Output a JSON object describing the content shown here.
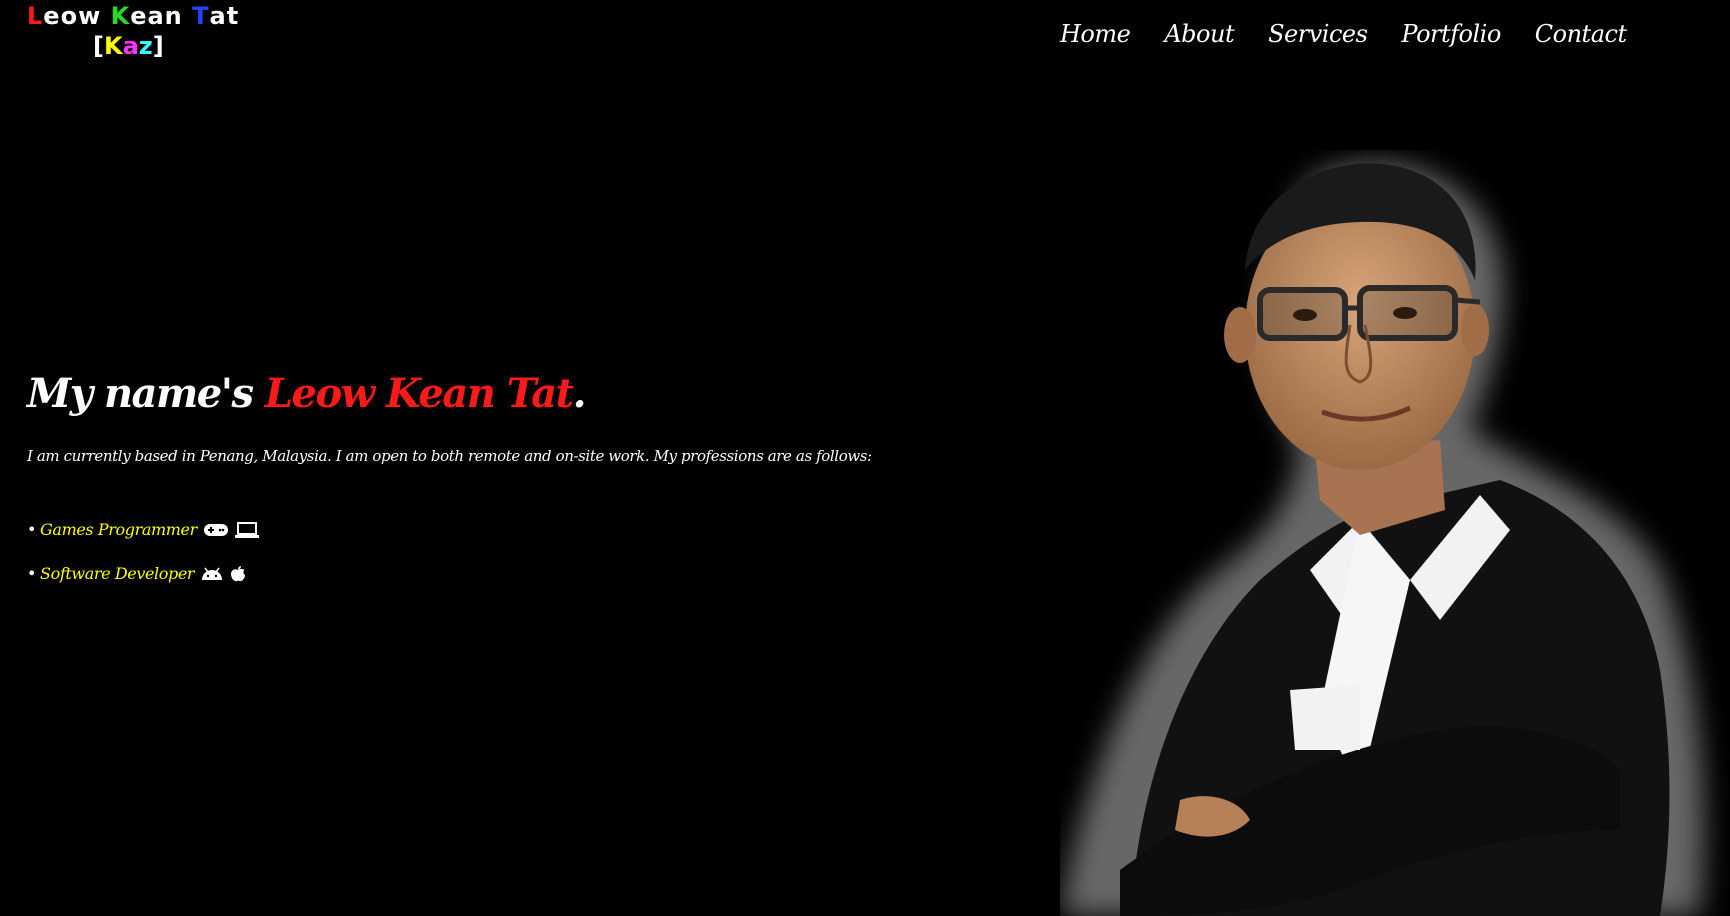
{
  "logo": {
    "line1": [
      {
        "t": "L",
        "c": "#ff1a1a"
      },
      {
        "t": "eow ",
        "c": "#ffffff"
      },
      {
        "t": "K",
        "c": "#22dd22"
      },
      {
        "t": "ean ",
        "c": "#ffffff"
      },
      {
        "t": "T",
        "c": "#2244ff"
      },
      {
        "t": "at",
        "c": "#ffffff"
      }
    ],
    "line2": [
      {
        "t": "[",
        "c": "#ffffff"
      },
      {
        "t": "K",
        "c": "#ffff00"
      },
      {
        "t": "a",
        "c": "#ff33ff"
      },
      {
        "t": "z",
        "c": "#33ffff"
      },
      {
        "t": "]",
        "c": "#ffffff"
      }
    ]
  },
  "nav": {
    "home": "Home",
    "about": "About",
    "services": "Services",
    "portfolio": "Portfolio",
    "contact": "Contact"
  },
  "hero": {
    "prefix": "My name's ",
    "name": "Leow Kean Tat",
    "suffix": ".",
    "intro": "I am currently based in Penang, Malaysia. I am open to both remote and on-site work. My professions are as follows:"
  },
  "professions": [
    {
      "bullet": "•",
      "label": "Games Programmer",
      "icons": [
        "gamepad-icon",
        "laptop-icon"
      ]
    },
    {
      "bullet": "•",
      "label": "Software Developer",
      "icons": [
        "android-icon",
        "apple-icon"
      ]
    }
  ],
  "colors": {
    "background": "#000000",
    "accent_name": "#ff1a1a",
    "profession": "#ffff00",
    "text": "#ffffff"
  }
}
